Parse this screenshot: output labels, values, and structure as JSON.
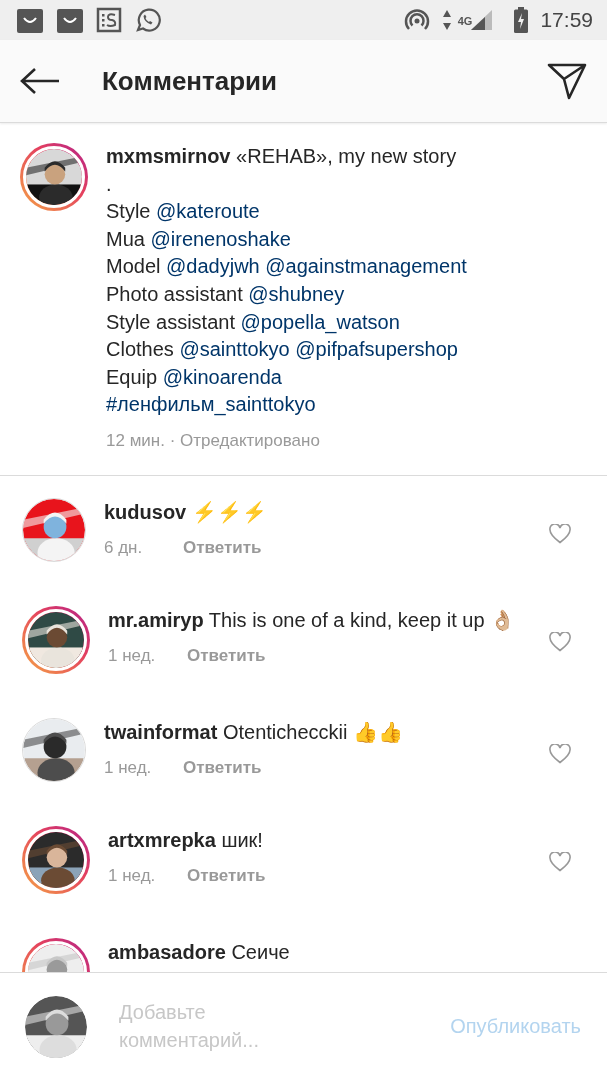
{
  "status_bar": {
    "network": "4G",
    "time": "17:59"
  },
  "header": {
    "title": "Комментарии"
  },
  "caption": {
    "username": "mxmsmirnov",
    "story_ring": true,
    "lines": [
      [
        {
          "kind": "plain",
          "text": "«REHAB», my new story"
        }
      ],
      [
        {
          "kind": "plain",
          "text": "."
        }
      ],
      [
        {
          "kind": "plain",
          "text": "Style"
        },
        {
          "kind": "mention",
          "text": "@kateroute"
        }
      ],
      [
        {
          "kind": "plain",
          "text": "Mua"
        },
        {
          "kind": "mention",
          "text": "@irenenoshake"
        }
      ],
      [
        {
          "kind": "plain",
          "text": "Model"
        },
        {
          "kind": "mention",
          "text": "@dadyjwh"
        },
        {
          "kind": "mention",
          "text": "@againstmanagement"
        }
      ],
      [
        {
          "kind": "plain",
          "text": "Photo assistant"
        },
        {
          "kind": "mention",
          "text": "@shubney"
        }
      ],
      [
        {
          "kind": "plain",
          "text": "Style assistant"
        },
        {
          "kind": "mention",
          "text": "@popella_watson"
        }
      ],
      [
        {
          "kind": "plain",
          "text": "Clothes"
        },
        {
          "kind": "mention",
          "text": "@sainttokyo"
        },
        {
          "kind": "mention",
          "text": "@pifpafsupershop"
        }
      ],
      [
        {
          "kind": "plain",
          "text": "Equip"
        },
        {
          "kind": "mention",
          "text": "@kinoarenda"
        }
      ],
      [
        {
          "kind": "mention",
          "text": "#ленфильм_sainttokyo"
        }
      ]
    ],
    "meta": "12 мин. · Отредактировано"
  },
  "comments": [
    {
      "username": "kudusov",
      "text": "⚡⚡⚡",
      "time": "6 дн.",
      "reply": "Ответить",
      "story_ring": false
    },
    {
      "username": "mr.amiryp",
      "text": "This is one of a kind, keep it up 👌🏼",
      "time": "1 нед.",
      "reply": "Ответить",
      "story_ring": true
    },
    {
      "username": "twainformat",
      "text": "Otentichecckii 👍👍",
      "time": "1 нед.",
      "reply": "Ответить",
      "story_ring": false
    },
    {
      "username": "artxmrepka",
      "text": "шик!",
      "time": "1 нед.",
      "reply": "Ответить",
      "story_ring": true
    },
    {
      "username": "ambasadore",
      "text": "Сеиче",
      "story_ring": true
    }
  ],
  "composer": {
    "placeholder": "Добавьте комментарий...",
    "publish": "Опубликовать"
  }
}
